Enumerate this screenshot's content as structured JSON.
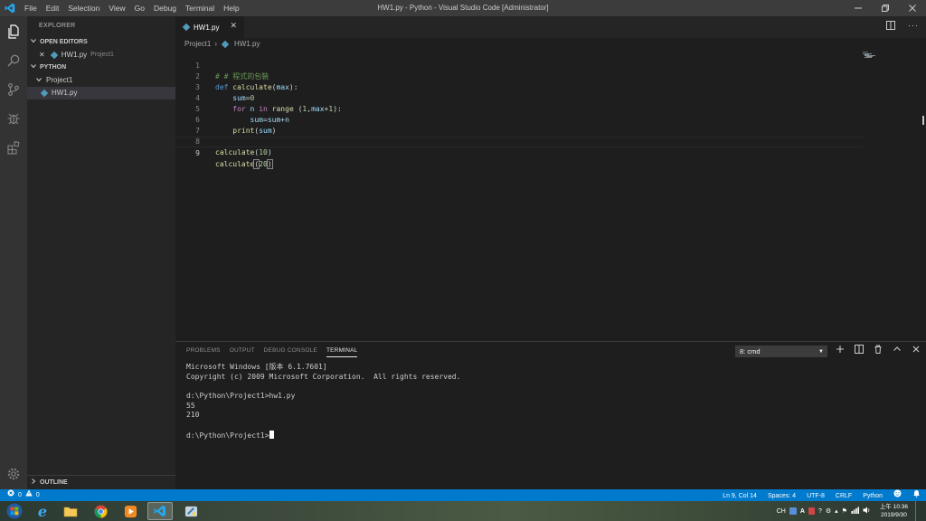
{
  "window": {
    "title": "HW1.py - Python - Visual Studio Code [Administrator]",
    "menu": [
      "File",
      "Edit",
      "Selection",
      "View",
      "Go",
      "Debug",
      "Terminal",
      "Help"
    ]
  },
  "sidebar": {
    "title": "EXPLORER",
    "open_editors_header": "OPEN EDITORS",
    "open_editor": {
      "file": "HW1.py",
      "folder": "Project1"
    },
    "workspace_header": "PYTHON",
    "folder": "Project1",
    "file": "HW1.py",
    "outline_header": "OUTLINE"
  },
  "editor": {
    "tab_label": "HW1.py",
    "breadcrumb": {
      "folder": "Project1",
      "file": "HW1.py"
    },
    "line_numbers": [
      "1",
      "2",
      "3",
      "4",
      "5",
      "6",
      "7",
      "8",
      "9"
    ],
    "code": {
      "l1": "# 程式的包裝",
      "l2_def": "def",
      "l2_name": "calculate",
      "l2_param": "max",
      "l3_var": "sum",
      "l3_val": "0",
      "l4_for": "for",
      "l4_n": "n",
      "l4_in": "in",
      "l4_range": "range",
      "l4_one": "1",
      "l4_max": "max",
      "l4_plus1": "1",
      "l5_sum": "sum",
      "l5_sum2": "sum",
      "l5_n": "n",
      "l6_print": "print",
      "l6_arg": "sum",
      "l8_call": "calculate",
      "l8_arg": "10",
      "l9_call": "calculate",
      "l9_arg": "20"
    }
  },
  "panel": {
    "tabs": [
      "PROBLEMS",
      "OUTPUT",
      "DEBUG CONSOLE",
      "TERMINAL"
    ],
    "terminal_select": "8: cmd",
    "terminal_lines": [
      "Microsoft Windows [版本 6.1.7601]",
      "Copyright (c) 2009 Microsoft Corporation.  All rights reserved.",
      "",
      "d:\\Python\\Project1>hw1.py",
      "55",
      "210",
      "",
      "d:\\Python\\Project1>"
    ]
  },
  "statusbar": {
    "errors": "0",
    "warnings": "0",
    "position": "Ln 9, Col 14",
    "spaces": "Spaces: 4",
    "encoding": "UTF-8",
    "eol": "CRLF",
    "language": "Python"
  },
  "taskbar": {
    "ime": "CH",
    "time": "上午 10:36",
    "date": "2019/9/30"
  },
  "colors": {
    "accent": "#007acc",
    "python_icon": "#519aba"
  }
}
